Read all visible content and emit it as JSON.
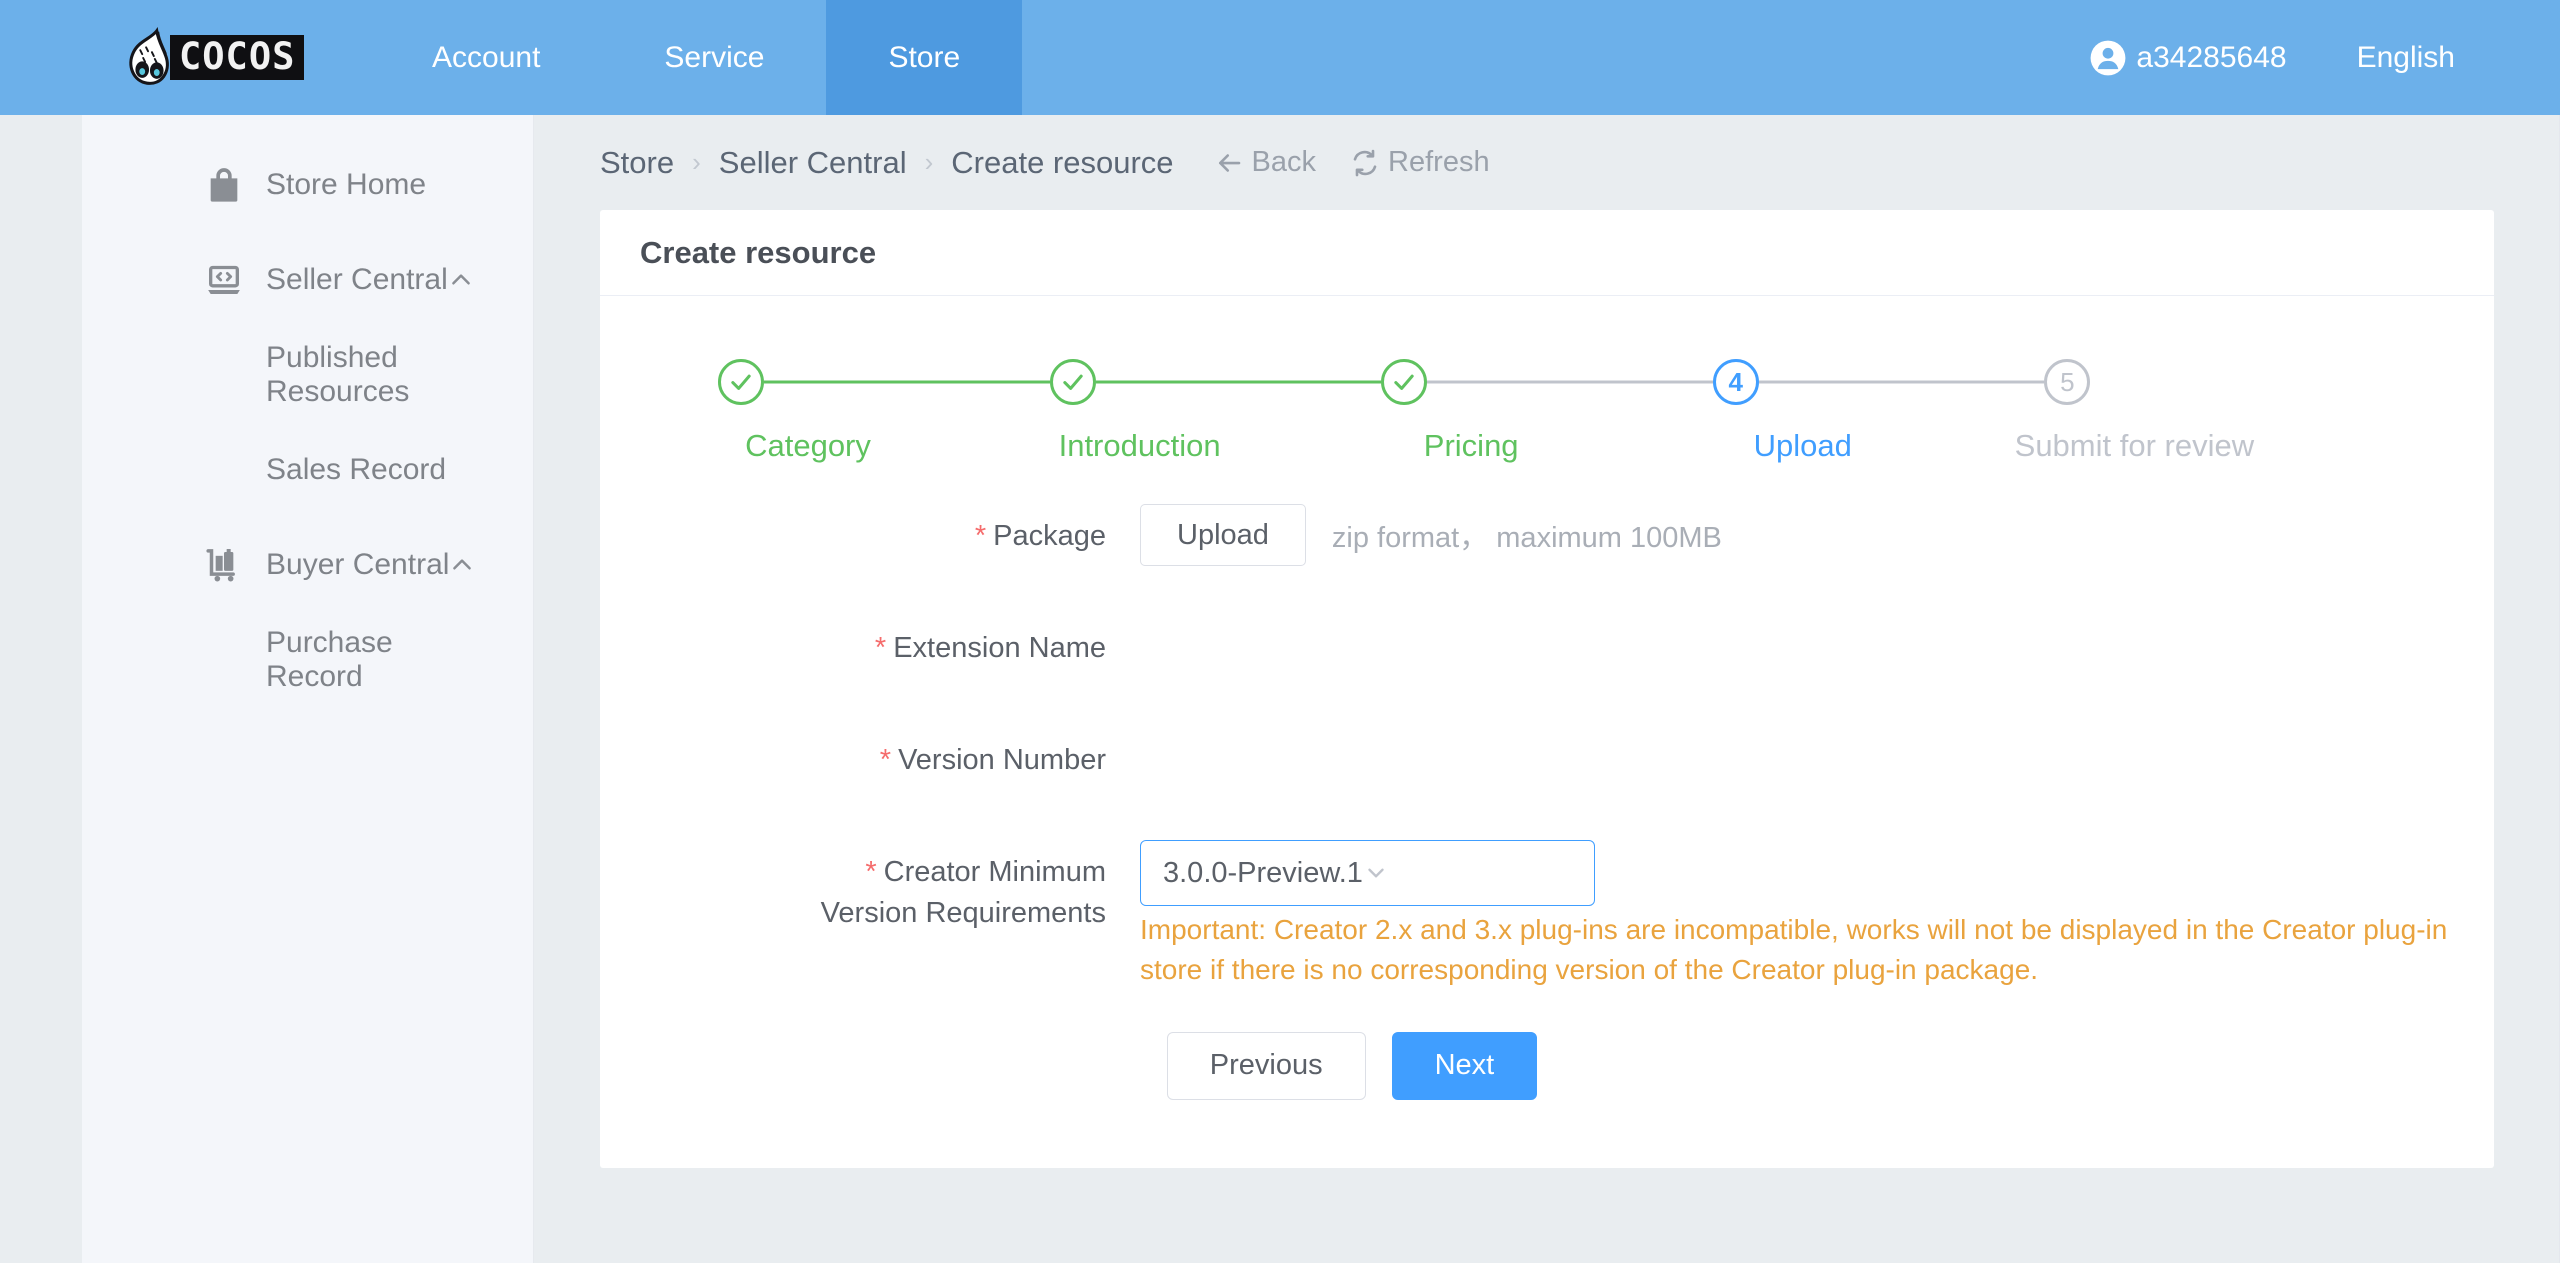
{
  "header": {
    "logo_text": "COCOS",
    "nav": [
      {
        "label": "Account",
        "active": false
      },
      {
        "label": "Service",
        "active": false
      },
      {
        "label": "Store",
        "active": true
      }
    ],
    "username": "a34285648",
    "user_icon": "user-avatar-icon",
    "language": "English",
    "bg_color": "#6cb0ea",
    "active_bg_color": "#4e9ae0"
  },
  "sidebar": {
    "items": [
      {
        "label": "Store Home",
        "icon": "shopping-bag-icon",
        "sub": false,
        "chevron": false
      },
      {
        "label": "Seller Central",
        "icon": "laptop-code-icon",
        "sub": false,
        "chevron": true
      },
      {
        "label": "Published Resources",
        "icon": "",
        "sub": true,
        "chevron": false
      },
      {
        "label": "Sales Record",
        "icon": "",
        "sub": true,
        "chevron": false
      },
      {
        "label": "Buyer Central",
        "icon": "luggage-cart-icon",
        "sub": false,
        "chevron": true
      },
      {
        "label": "Purchase Record",
        "icon": "",
        "sub": true,
        "chevron": false
      }
    ]
  },
  "breadcrumb": {
    "items": [
      "Store",
      "Seller Central",
      "Create resource"
    ],
    "separator": "›",
    "actions": [
      {
        "label": "Back",
        "icon": "arrow-left-icon"
      },
      {
        "label": "Refresh",
        "icon": "refresh-icon"
      }
    ]
  },
  "card": {
    "title": "Create resource"
  },
  "steps": {
    "items": [
      {
        "label": "Category",
        "status": "done",
        "number": "1"
      },
      {
        "label": "Introduction",
        "status": "done",
        "number": "2"
      },
      {
        "label": "Pricing",
        "status": "done",
        "number": "3"
      },
      {
        "label": "Upload",
        "status": "active",
        "number": "4"
      },
      {
        "label": "Submit for review",
        "status": "inactive",
        "number": "5"
      }
    ],
    "done_color": "#5fc25f",
    "active_color": "#409eff",
    "inactive_color": "#c0c4cc"
  },
  "form": {
    "package": {
      "label": "Package",
      "required": true,
      "upload_button": "Upload",
      "hint": "zip format， maximum 100MB"
    },
    "extension_name": {
      "label": "Extension Name",
      "required": true,
      "value": ""
    },
    "version_number": {
      "label": "Version Number",
      "required": true,
      "value": ""
    },
    "creator_minimum": {
      "label": "Creator Minimum Version Requirements",
      "label_line1": "Creator Minimum",
      "label_line2": "Version Requirements",
      "required": true,
      "selected": "3.0.0-Preview.1",
      "warning": "Important: Creator 2.x and 3.x plug-ins are incompatible, works will not be displayed in the Creator plug-in store if there is no corresponding version of the Creator plug-in package.",
      "warning_color": "#e9a33e"
    },
    "buttons": {
      "previous": "Previous",
      "next": "Next"
    }
  }
}
